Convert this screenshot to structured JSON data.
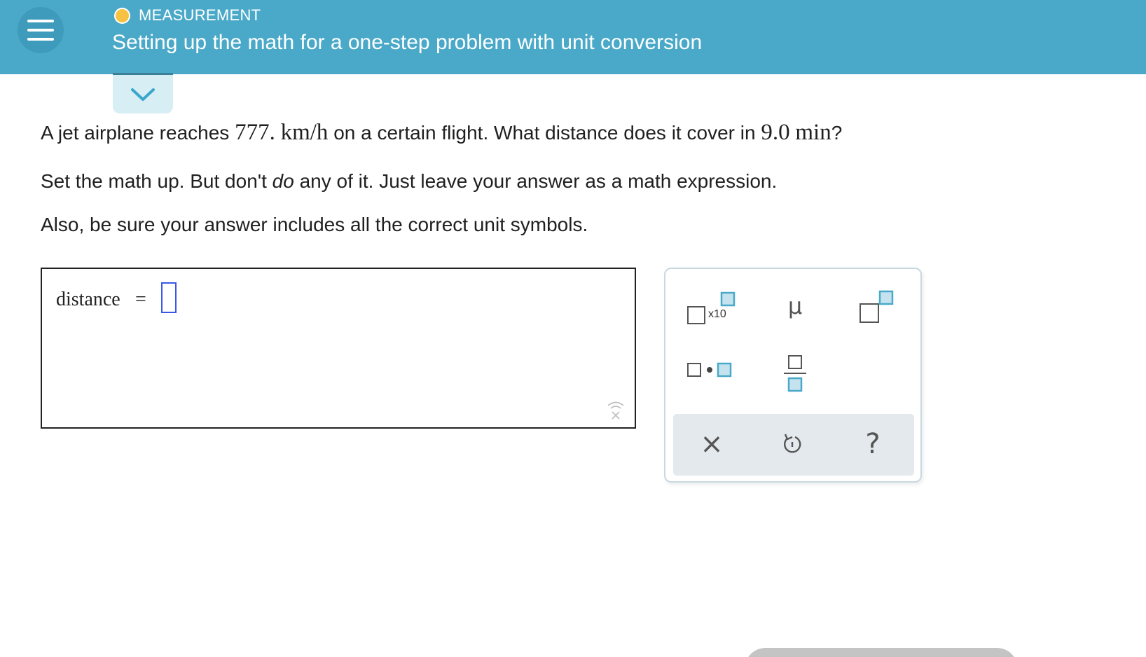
{
  "header": {
    "topic": "MEASUREMENT",
    "title": "Setting up the math for a one-step problem with unit conversion",
    "topic_dot_color": "#f7c242",
    "background": "#4aa9c8"
  },
  "question": {
    "line1_pre": "A jet airplane reaches",
    "speed": "777.",
    "speed_unit": "km/h",
    "line1_mid": "on a certain flight. What distance does it cover in",
    "time": "9.0",
    "time_unit": "min",
    "line1_end": "?",
    "line2_pre": "Set the math up. But don't",
    "line2_em": "do",
    "line2_post": "any of it. Just leave your answer as a math expression.",
    "line3": "Also, be sure your answer includes all the correct unit symbols."
  },
  "answer": {
    "label": "distance",
    "equals": "="
  },
  "keypad": {
    "sci_notation_label": "x10",
    "mu_label": "μ",
    "clear_label": "×",
    "help_label": "?",
    "icons": [
      "scientific-notation-icon",
      "mu-icon",
      "superscript-icon",
      "multiply-dot-icon",
      "fraction-icon",
      "clear-icon",
      "undo-icon",
      "help-icon"
    ]
  }
}
